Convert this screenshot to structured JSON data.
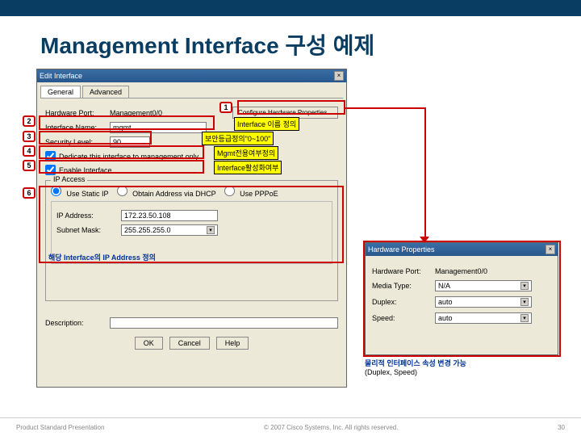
{
  "slide": {
    "title": "Management Interface 구성 예제"
  },
  "editWindow": {
    "title": "Edit Interface",
    "tabs": {
      "general": "General",
      "advanced": "Advanced"
    },
    "hardwarePortLabel": "Hardware Port:",
    "hardwarePortValue": "Management0/0",
    "configureBtn": "Configure Hardware Properties...",
    "interfaceNameLabel": "Interface Name:",
    "interfaceNameValue": "mgmt",
    "securityLevelLabel": "Security Level:",
    "securityLevelValue": "90",
    "dedicateChk": "Dedicate this interface to management only",
    "enableChk": "Enable Interface",
    "ipAccess": {
      "frame": "IP Access",
      "staticRadio": "Use Static IP",
      "dhcpRadio": "Obtain Address via DHCP",
      "pppoeRadio": "Use PPPoE",
      "ipLabel": "IP Address:",
      "ipValue": "172.23.50.108",
      "maskLabel": "Subnet Mask:",
      "maskValue": "255.255.255.0"
    },
    "descriptionLabel": "Description:",
    "descriptionValue": "",
    "ok": "OK",
    "cancel": "Cancel",
    "help": "Help"
  },
  "callouts": {
    "c1": "1",
    "c2": "2",
    "c3": "3",
    "c4": "4",
    "c5": "5",
    "c6": "6",
    "label2": "Interface 이름 정의",
    "label3": "보안등급정의\"0~100\"",
    "label4": "Mgmt전용여부정의",
    "label5": "Interface활성화여부",
    "label6": "해당 Interface의 IP Address 정의"
  },
  "hwWindow": {
    "title": "Hardware Properties",
    "portLabel": "Hardware Port:",
    "portValue": "Management0/0",
    "duplexLabel": "Duplex:",
    "duplexValue": "auto",
    "mediaLabel": "Media Type:",
    "mediaValue": "N/A",
    "speedLabel": "Speed:",
    "speedValue": "auto"
  },
  "bottomNote": {
    "kr": "물리적 인터페이스 속성 변경 가능",
    "en": "(Duplex, Speed)"
  },
  "footer": {
    "left": "Product Standard Presentation",
    "mid": "© 2007 Cisco Systems, Inc. All rights reserved.",
    "page": "30"
  }
}
